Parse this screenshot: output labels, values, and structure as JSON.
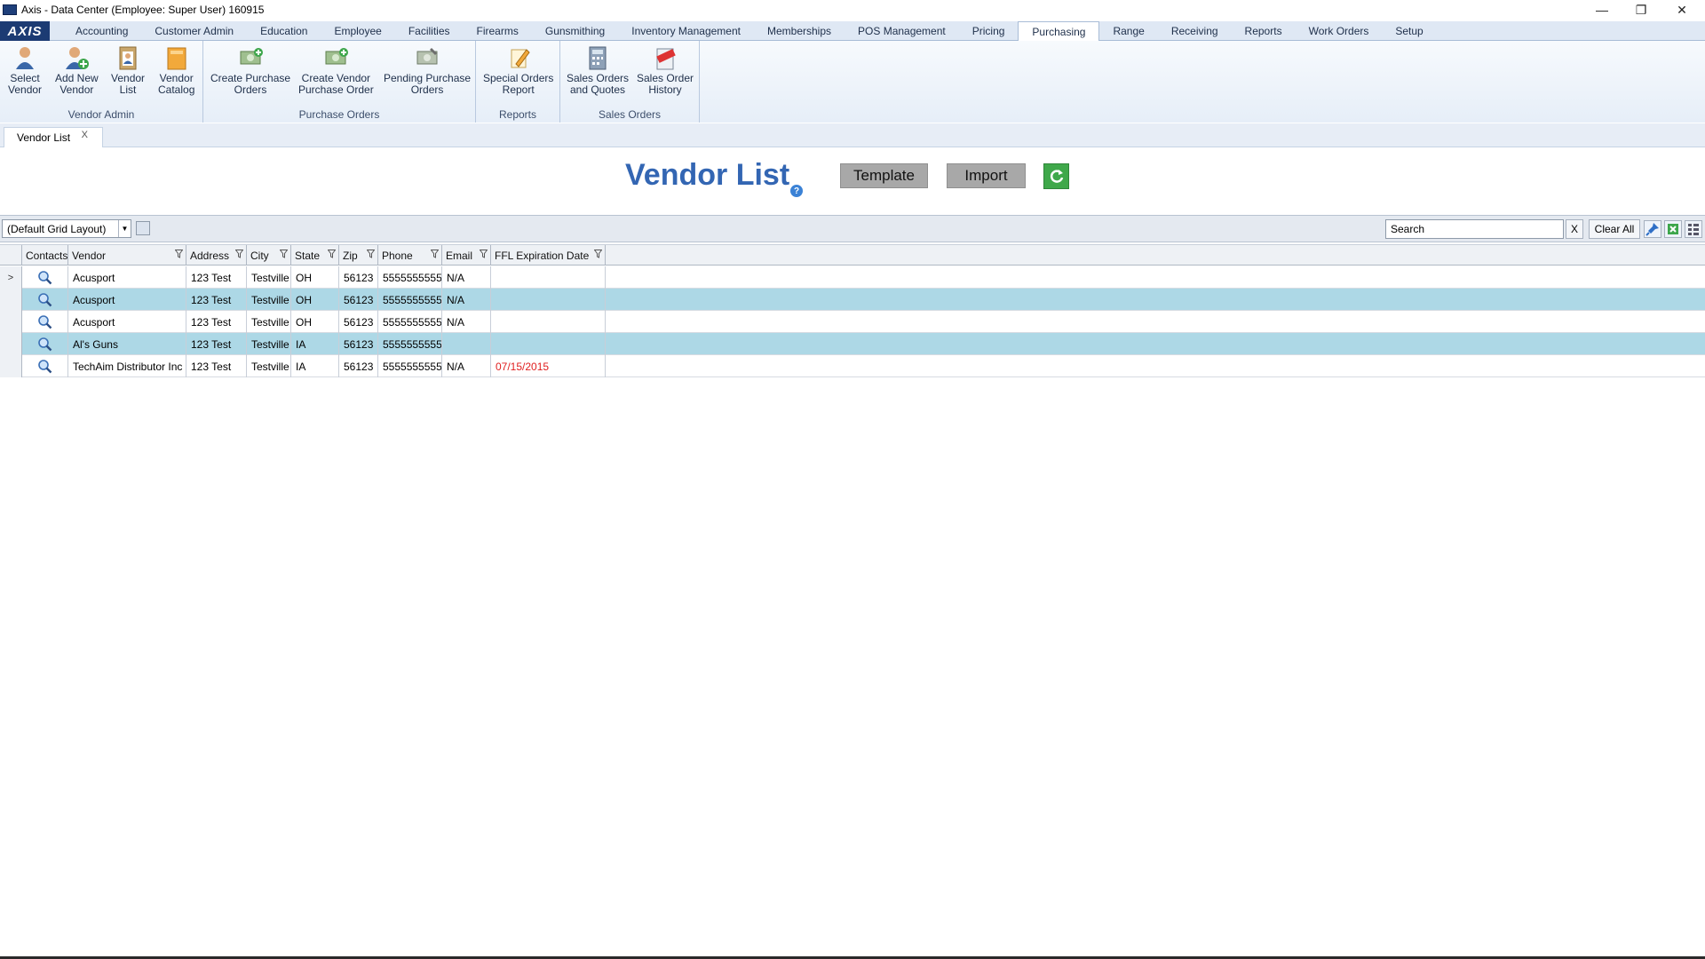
{
  "window": {
    "title": "Axis - Data Center  (Employee: Super User) 160915",
    "controls": {
      "minimize": "—",
      "restore": "❐",
      "close": "✕"
    }
  },
  "menu": {
    "logo": "AXIS",
    "tabs": [
      "Accounting",
      "Customer Admin",
      "Education",
      "Employee",
      "Facilities",
      "Firearms",
      "Gunsmithing",
      "Inventory Management",
      "Memberships",
      "POS Management",
      "Pricing",
      "Purchasing",
      "Range",
      "Receiving",
      "Reports",
      "Work Orders",
      "Setup"
    ],
    "active": "Purchasing"
  },
  "ribbon": {
    "groups": [
      {
        "label": "Vendor Admin",
        "buttons": [
          "Select\nVendor",
          "Add New\nVendor",
          "Vendor\nList",
          "Vendor\nCatalog"
        ]
      },
      {
        "label": "Purchase Orders",
        "buttons": [
          "Create Purchase\nOrders",
          "Create Vendor\nPurchase Order",
          "Pending Purchase\nOrders"
        ]
      },
      {
        "label": "Reports",
        "buttons": [
          "Special Orders\nReport"
        ]
      },
      {
        "label": "Sales Orders",
        "buttons": [
          "Sales Orders\nand Quotes",
          "Sales Order\nHistory"
        ]
      }
    ]
  },
  "doc_tab": {
    "label": "Vendor List",
    "close": "X"
  },
  "header": {
    "title": "Vendor List",
    "help": "?",
    "template_label": "Template",
    "import_label": "Import"
  },
  "toolbar": {
    "layout": "(Default Grid Layout)",
    "search_placeholder": "Search",
    "clear_x": "X",
    "clear_all": "Clear All"
  },
  "grid": {
    "columns": [
      "Contacts",
      "Vendor",
      "Address",
      "City",
      "State",
      "Zip",
      "Phone",
      "Email",
      "FFL Expiration Date"
    ],
    "rows": [
      {
        "vendor": "Acusport",
        "address": "123 Test",
        "city": "Testville",
        "state": "OH",
        "zip": "56123",
        "phone": "5555555555",
        "email": "N/A",
        "ffl": ""
      },
      {
        "vendor": "Acusport",
        "address": "123 Test",
        "city": "Testville",
        "state": "OH",
        "zip": "56123",
        "phone": "5555555555",
        "email": "N/A",
        "ffl": ""
      },
      {
        "vendor": "Acusport",
        "address": "123 Test",
        "city": "Testville",
        "state": "OH",
        "zip": "56123",
        "phone": "5555555555",
        "email": "N/A",
        "ffl": ""
      },
      {
        "vendor": "Al's Guns",
        "address": "123 Test",
        "city": "Testville",
        "state": "IA",
        "zip": "56123",
        "phone": "5555555555",
        "email": "",
        "ffl": ""
      },
      {
        "vendor": "TechAim Distributor Inc",
        "address": "123 Test",
        "city": "Testville",
        "state": "IA",
        "zip": "56123",
        "phone": "5555555555",
        "email": "N/A",
        "ffl": "07/15/2015"
      }
    ],
    "current_row_marker": ">"
  },
  "colors": {
    "accent": "#3366b3",
    "row_alt": "#add8e6",
    "expired": "#e02020",
    "refresh": "#3fa84a"
  }
}
